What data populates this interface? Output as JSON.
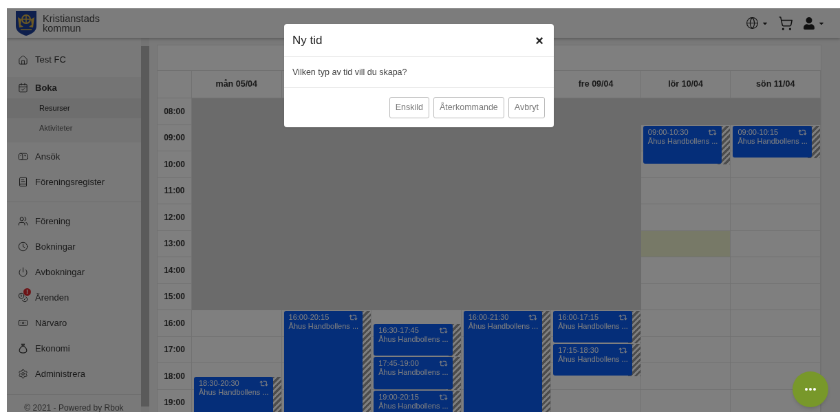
{
  "header": {
    "brand": "Kristianstads kommun"
  },
  "sidebar": {
    "groups": [
      [
        {
          "label": "Test FC",
          "expanded": false
        },
        {
          "label": "Boka",
          "expanded": true,
          "children": [
            {
              "label": "Resurser",
              "selected": true
            },
            {
              "label": "Aktiviteter",
              "selected": false
            }
          ]
        }
      ],
      [
        {
          "label": "Ansök",
          "expanded": false
        },
        {
          "label": "Föreningsregister",
          "expanded": false
        }
      ],
      [
        {
          "label": "Förening",
          "expanded": false
        },
        {
          "label": "Bokningar",
          "expanded": false
        },
        {
          "label": "Avbokningar",
          "expanded": false
        },
        {
          "label": "Ärenden",
          "expanded": false,
          "badge": "!"
        },
        {
          "label": "Närvaro",
          "expanded": false
        },
        {
          "label": "Ekonomi",
          "expanded": false
        },
        {
          "label": "Administrera",
          "expanded": false
        }
      ]
    ],
    "footer": "© 2021 - Powered by Rbok"
  },
  "calendar": {
    "days": [
      {
        "label": "mån 05/04",
        "events": [
          {
            "time": "18:30-20:30",
            "title": "Åhus Handbollens ...",
            "recurring": true
          }
        ]
      },
      {
        "events": [
          {
            "time": "16:00-20:15",
            "title": "Åhus Handbollens ...",
            "recurring": true
          }
        ]
      },
      {
        "events": [
          {
            "time": "16:30-17:45",
            "title": "Åhus Handbollens ...",
            "recurring": true
          },
          {
            "time": "17:45-19:00",
            "title": "Åhus Handbollens ...",
            "recurring": true
          },
          {
            "time": "19:00-20:15",
            "title": "Åhus Handbollens ...",
            "recurring": true
          }
        ]
      },
      {
        "events": [
          {
            "time": "16:00-21:30",
            "title": "Åhus Handbollens ...",
            "recurring": true
          }
        ]
      },
      {
        "label": "fre 09/04",
        "events": [
          {
            "time": "16:00-17:15",
            "title": "Åhus Handbollens ...",
            "recurring": true
          },
          {
            "time": "17:15-18:30",
            "title": "Åhus Handbollens ...",
            "recurring": true
          }
        ]
      },
      {
        "label": "lör 10/04",
        "events": [
          {
            "time": "09:00-10:30",
            "title": "Åhus Handbollens ...",
            "recurring": true
          }
        ]
      },
      {
        "label": "sön 11/04",
        "events": [
          {
            "time": "09:00-10:15",
            "title": "Åhus Handbollens ...",
            "recurring": true
          }
        ]
      }
    ],
    "rows": [
      {
        "time": "08:00",
        "slots": [
          {
            "kind": "closed"
          },
          {
            "kind": "closed"
          },
          {
            "kind": "closed"
          },
          {
            "kind": "closed"
          },
          {
            "kind": "closed"
          },
          {
            "kind": "closed"
          },
          {
            "kind": "closed"
          }
        ]
      },
      {
        "time": "09:00",
        "slots": [
          {
            "kind": "closed"
          },
          {
            "kind": "closed"
          },
          {
            "kind": "closed"
          },
          {
            "kind": "closed"
          },
          {
            "kind": "closed"
          },
          {
            "kind": "open"
          },
          {
            "kind": "open"
          }
        ]
      },
      {
        "time": "10:00",
        "slots": [
          {
            "kind": "closed"
          },
          {
            "kind": "closed"
          },
          {
            "kind": "closed"
          },
          {
            "kind": "closed"
          },
          {
            "kind": "closed"
          },
          {
            "kind": "open"
          },
          {
            "kind": "open"
          }
        ]
      },
      {
        "time": "11:00",
        "slots": [
          {
            "kind": "closed"
          },
          {
            "kind": "closed"
          },
          {
            "kind": "closed"
          },
          {
            "kind": "closed"
          },
          {
            "kind": "closed"
          },
          {
            "kind": "open"
          },
          {
            "kind": "open"
          }
        ]
      },
      {
        "time": "12:00",
        "slots": [
          {
            "kind": "closed"
          },
          {
            "kind": "closed"
          },
          {
            "kind": "closed"
          },
          {
            "kind": "closed"
          },
          {
            "kind": "closed"
          },
          {
            "kind": "open"
          },
          {
            "kind": "open"
          }
        ]
      },
      {
        "time": "13:00",
        "slots": [
          {
            "kind": "closed"
          },
          {
            "kind": "closed"
          },
          {
            "kind": "closed"
          },
          {
            "kind": "closed"
          },
          {
            "kind": "closed"
          },
          {
            "kind": "selected"
          },
          {
            "kind": "open"
          }
        ]
      },
      {
        "time": "14:00",
        "slots": [
          {
            "kind": "closed"
          },
          {
            "kind": "closed"
          },
          {
            "kind": "closed"
          },
          {
            "kind": "closed"
          },
          {
            "kind": "closed"
          },
          {
            "kind": "open"
          },
          {
            "kind": "open"
          }
        ]
      },
      {
        "time": "15:00",
        "slots": [
          {
            "kind": "closed"
          },
          {
            "kind": "closed"
          },
          {
            "kind": "closed"
          },
          {
            "kind": "closed"
          },
          {
            "kind": "closed"
          },
          {
            "kind": "open"
          },
          {
            "kind": "open"
          }
        ]
      },
      {
        "time": "16:00",
        "slots": [
          {
            "kind": "open"
          },
          {
            "kind": "open"
          },
          {
            "kind": "open"
          },
          {
            "kind": "open"
          },
          {
            "kind": "open"
          },
          {
            "kind": "open"
          },
          {
            "kind": "open"
          }
        ]
      },
      {
        "time": "17:00",
        "slots": [
          {
            "kind": "open"
          },
          {
            "kind": "open"
          },
          {
            "kind": "open"
          },
          {
            "kind": "open"
          },
          {
            "kind": "open"
          },
          {
            "kind": "open"
          },
          {
            "kind": "open"
          }
        ]
      },
      {
        "time": "18:00",
        "slots": [
          {
            "kind": "open"
          },
          {
            "kind": "open"
          },
          {
            "kind": "open"
          },
          {
            "kind": "open"
          },
          {
            "kind": "open"
          },
          {
            "kind": "open"
          },
          {
            "kind": "open"
          }
        ]
      },
      {
        "time": "19:00",
        "slots": [
          {
            "kind": "open"
          },
          {
            "kind": "open"
          },
          {
            "kind": "open"
          },
          {
            "kind": "open"
          },
          {
            "kind": "open"
          },
          {
            "kind": "open"
          },
          {
            "kind": "open"
          }
        ]
      }
    ]
  },
  "dialog": {
    "title": "Ny tid",
    "close": "×",
    "message": "Vilken typ av tid vill du skapa?",
    "buttons": [
      "Enskild",
      "Återkommande",
      "Avbryt"
    ]
  }
}
